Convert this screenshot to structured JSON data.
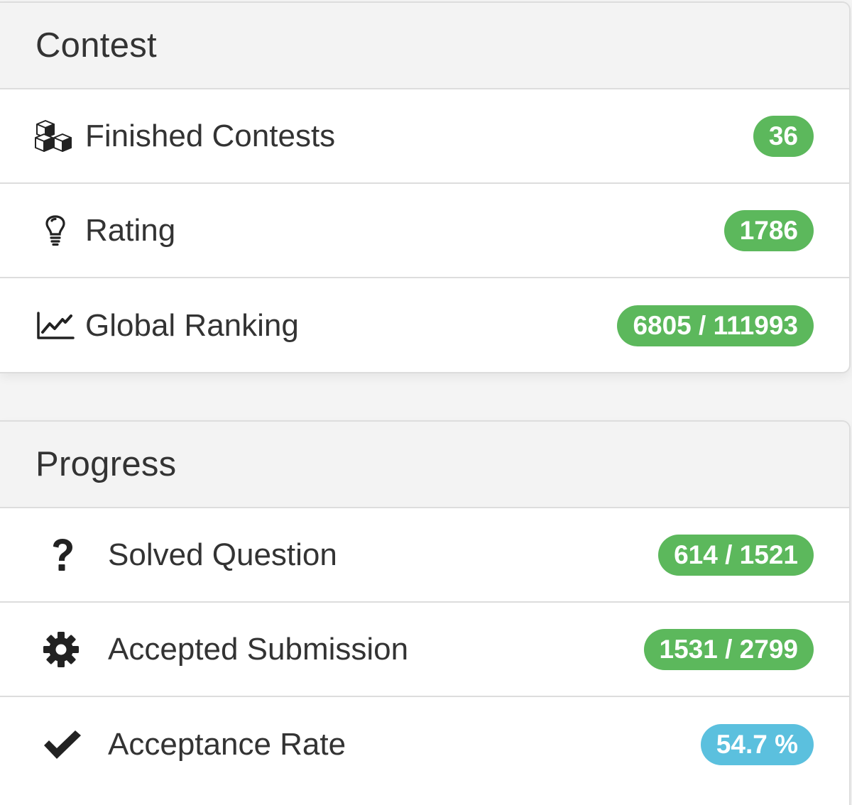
{
  "contest": {
    "title": "Contest",
    "items": [
      {
        "icon": "cubes-icon",
        "label": "Finished Contests",
        "value": "36",
        "badge_color": "#5cb85c"
      },
      {
        "icon": "lightbulb-icon",
        "label": "Rating",
        "value": "1786",
        "badge_color": "#5cb85c"
      },
      {
        "icon": "line-chart-icon",
        "label": "Global Ranking",
        "value": "6805 / 111993",
        "badge_color": "#5cb85c"
      }
    ]
  },
  "progress": {
    "title": "Progress",
    "items": [
      {
        "icon": "question-icon",
        "label": "Solved Question",
        "value": "614 / 1521",
        "badge_color": "#5cb85c"
      },
      {
        "icon": "gear-icon",
        "label": "Accepted Submission",
        "value": "1531 / 2799",
        "badge_color": "#5cb85c"
      },
      {
        "icon": "check-icon",
        "label": "Acceptance Rate",
        "value": "54.7 %",
        "badge_color": "#5bc0de"
      }
    ]
  }
}
